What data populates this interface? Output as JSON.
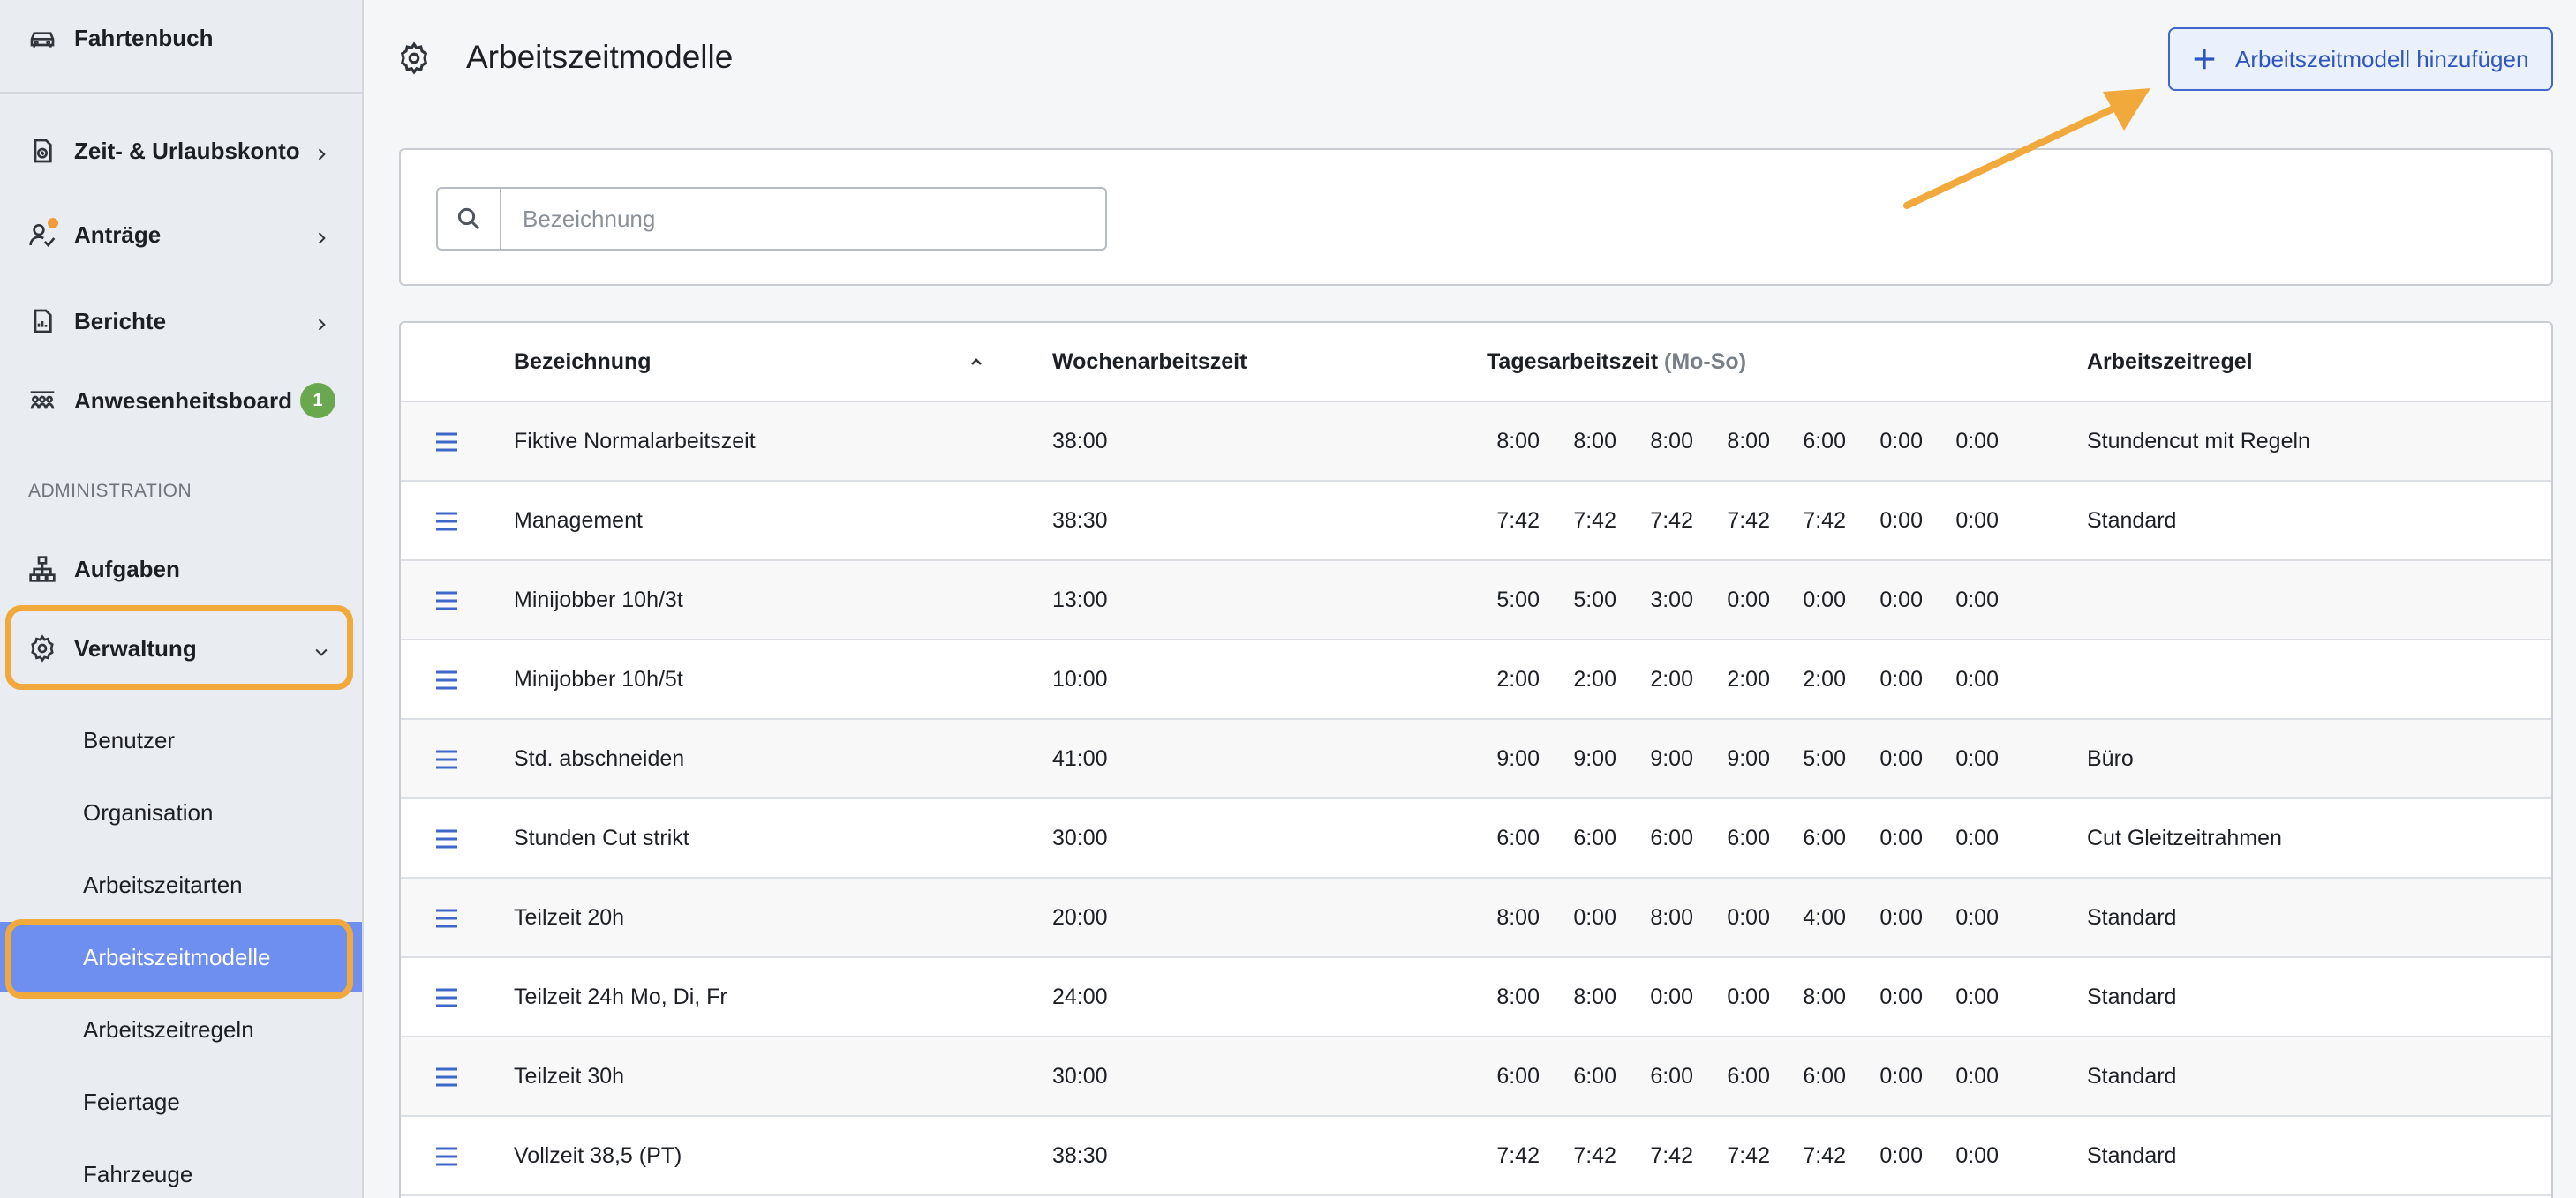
{
  "sidebar": {
    "top_item": {
      "label": "Fahrtenbuch",
      "icon": "car-icon"
    },
    "items": [
      {
        "label": "Zeit- & Urlaubskonto",
        "icon": "document-clock-icon",
        "chevron": "chevron-right-icon"
      },
      {
        "label": "Anträge",
        "icon": "user-check-icon",
        "chevron": "chevron-right-icon",
        "notification_dot": true
      },
      {
        "label": "Berichte",
        "icon": "report-icon",
        "chevron": "chevron-right-icon"
      },
      {
        "label": "Anwesenheitsboard",
        "icon": "people-board-icon",
        "badge": "1"
      }
    ],
    "section_label": "ADMINISTRATION",
    "admin_items": [
      {
        "label": "Aufgaben",
        "icon": "hierarchy-icon"
      },
      {
        "label": "Verwaltung",
        "icon": "gear-icon",
        "chevron": "chevron-down-icon",
        "expanded": true
      }
    ],
    "sub_items": [
      {
        "label": "Benutzer"
      },
      {
        "label": "Organisation"
      },
      {
        "label": "Arbeitszeitarten"
      },
      {
        "label": "Arbeitszeitmodelle",
        "active": true
      },
      {
        "label": "Arbeitszeitregeln"
      },
      {
        "label": "Feiertage"
      },
      {
        "label": "Fahrzeuge"
      }
    ]
  },
  "header": {
    "title": "Arbeitszeitmodelle",
    "add_button_label": "Arbeitszeitmodell hinzufügen"
  },
  "search": {
    "placeholder": "Bezeichnung",
    "value": ""
  },
  "table": {
    "columns": {
      "name": "Bezeichnung",
      "weekly": "Wochenarbeitszeit",
      "daily": "Tagesarbeitszeit",
      "daily_suffix": "(Mo-So)",
      "rule": "Arbeitszeitregel"
    },
    "rows": [
      {
        "name": "Fiktive Normalarbeitszeit",
        "weekly": "38:00",
        "days": [
          "8:00",
          "8:00",
          "8:00",
          "8:00",
          "6:00",
          "0:00",
          "0:00"
        ],
        "rule": "Stundencut mit Regeln"
      },
      {
        "name": "Management",
        "weekly": "38:30",
        "days": [
          "7:42",
          "7:42",
          "7:42",
          "7:42",
          "7:42",
          "0:00",
          "0:00"
        ],
        "rule": "Standard"
      },
      {
        "name": "Minijobber 10h/3t",
        "weekly": "13:00",
        "days": [
          "5:00",
          "5:00",
          "3:00",
          "0:00",
          "0:00",
          "0:00",
          "0:00"
        ],
        "rule": ""
      },
      {
        "name": "Minijobber 10h/5t",
        "weekly": "10:00",
        "days": [
          "2:00",
          "2:00",
          "2:00",
          "2:00",
          "2:00",
          "0:00",
          "0:00"
        ],
        "rule": ""
      },
      {
        "name": "Std. abschneiden",
        "weekly": "41:00",
        "days": [
          "9:00",
          "9:00",
          "9:00",
          "9:00",
          "5:00",
          "0:00",
          "0:00"
        ],
        "rule": "Büro"
      },
      {
        "name": "Stunden Cut strikt",
        "weekly": "30:00",
        "days": [
          "6:00",
          "6:00",
          "6:00",
          "6:00",
          "6:00",
          "0:00",
          "0:00"
        ],
        "rule": "Cut Gleitzeitrahmen"
      },
      {
        "name": "Teilzeit 20h",
        "weekly": "20:00",
        "days": [
          "8:00",
          "0:00",
          "8:00",
          "0:00",
          "4:00",
          "0:00",
          "0:00"
        ],
        "rule": "Standard"
      },
      {
        "name": "Teilzeit 24h Mo, Di, Fr",
        "weekly": "24:00",
        "days": [
          "8:00",
          "8:00",
          "0:00",
          "0:00",
          "8:00",
          "0:00",
          "0:00"
        ],
        "rule": "Standard"
      },
      {
        "name": "Teilzeit 30h",
        "weekly": "30:00",
        "days": [
          "6:00",
          "6:00",
          "6:00",
          "6:00",
          "6:00",
          "0:00",
          "0:00"
        ],
        "rule": "Standard"
      },
      {
        "name": "Vollzeit 38,5 (PT)",
        "weekly": "38:30",
        "days": [
          "7:42",
          "7:42",
          "7:42",
          "7:42",
          "7:42",
          "0:00",
          "0:00"
        ],
        "rule": "Standard"
      }
    ]
  },
  "colors": {
    "accent": "#3f66c9",
    "active_nav": "#6e8ff0",
    "highlight": "#f2a93b",
    "badge": "#6aa84f"
  }
}
